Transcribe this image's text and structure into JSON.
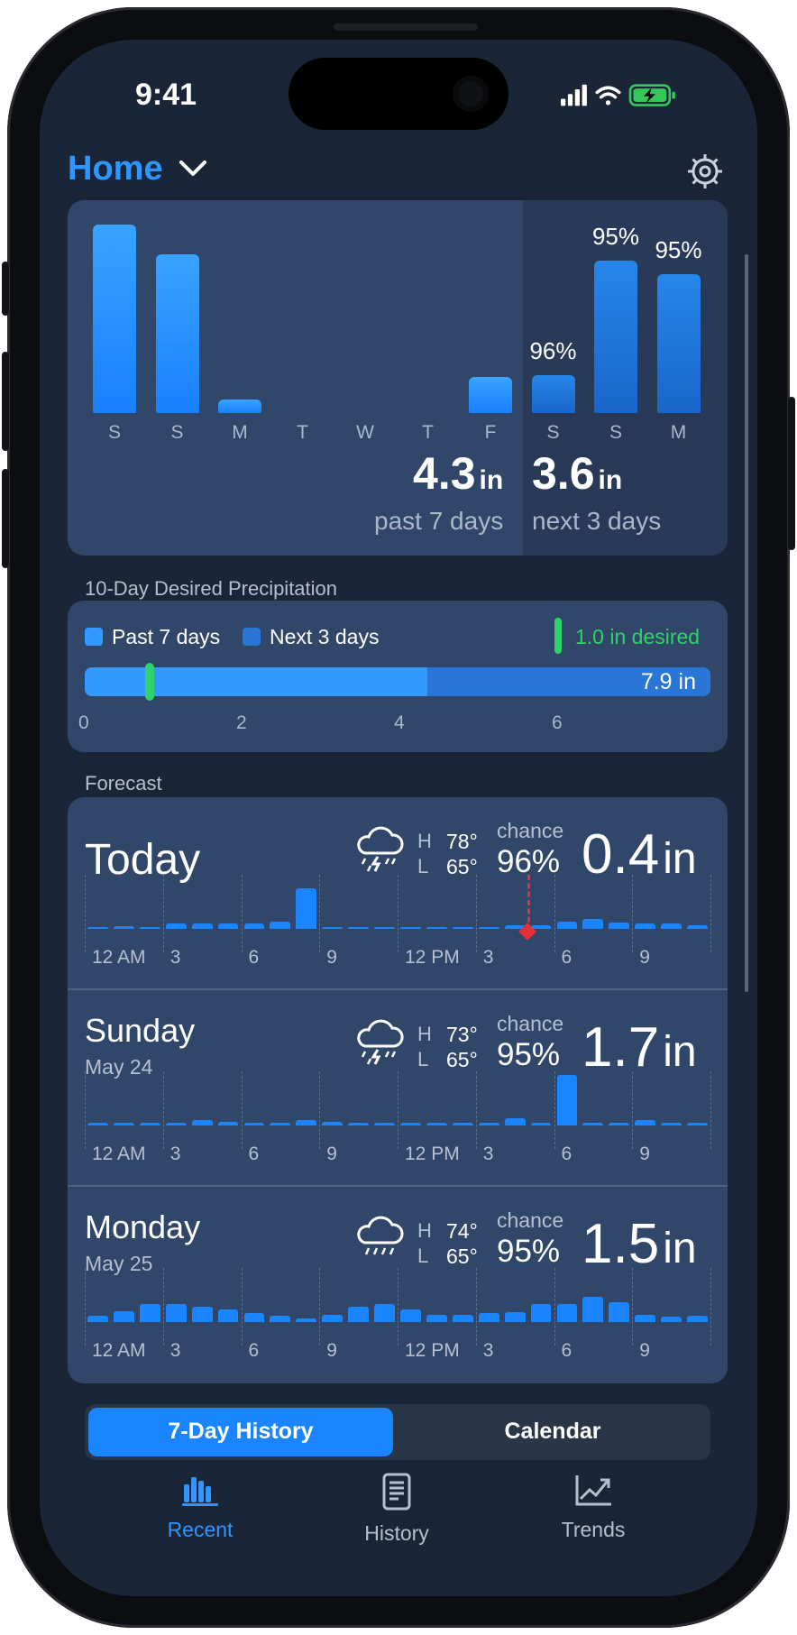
{
  "status": {
    "time": "9:41"
  },
  "header": {
    "location": "Home"
  },
  "summary": {
    "days": [
      "S",
      "S",
      "M",
      "T",
      "W",
      "T",
      "F",
      "S",
      "S",
      "M"
    ],
    "past_values": [
      0.95,
      0.8,
      0.07,
      0,
      0,
      0,
      0.18
    ],
    "future_values": [
      0.19,
      0.77,
      0.7
    ],
    "future_chances": [
      "96%",
      "95%",
      "95%"
    ],
    "past_total": "4.3",
    "past_total_unit": "in",
    "past_label": "past 7 days",
    "next_total": "3.6",
    "next_total_unit": "in",
    "next_label": "next 3 days"
  },
  "desired": {
    "section_title": "10-Day Desired Precipitation",
    "legend_past": "Past 7 days",
    "legend_next": "Next 3 days",
    "desired_label": "1.0 in desired",
    "total_label": "7.9 in",
    "axis": [
      "0",
      "2",
      "4",
      "6"
    ]
  },
  "forecast": {
    "section_title": "Forecast",
    "days": [
      {
        "name": "Today",
        "date": "",
        "high": "78°",
        "low": "65°",
        "chance_label": "chance",
        "chance": "96%",
        "amount": "0.4",
        "unit": "in",
        "icon": "thunderstorm-icon",
        "hours": [
          0,
          0.06,
          0,
          0.1,
          0.1,
          0.1,
          0.1,
          0.15,
          0.8,
          0,
          0,
          0,
          0,
          0,
          0,
          0,
          0.08,
          0.08,
          0.15,
          0.2,
          0.12,
          0.1,
          0.1,
          0.08
        ]
      },
      {
        "name": "Sunday",
        "date": "May 24",
        "high": "73°",
        "low": "65°",
        "chance_label": "chance",
        "chance": "95%",
        "amount": "1.7",
        "unit": "in",
        "icon": "thunderstorm-icon",
        "hours": [
          0.05,
          0.05,
          0.05,
          0.05,
          0.1,
          0.08,
          0.05,
          0.05,
          0.1,
          0.08,
          0.05,
          0.05,
          0.05,
          0.05,
          0.05,
          0.05,
          0.15,
          0.05,
          1.0,
          0.05,
          0.05,
          0.1,
          0.05,
          0.05
        ]
      },
      {
        "name": "Monday",
        "date": "May 25",
        "high": "74°",
        "low": "65°",
        "chance_label": "chance",
        "chance": "95%",
        "amount": "1.5",
        "unit": "in",
        "icon": "rain-icon",
        "hours": [
          0.12,
          0.22,
          0.35,
          0.35,
          0.3,
          0.25,
          0.18,
          0.12,
          0.08,
          0.15,
          0.3,
          0.35,
          0.25,
          0.15,
          0.15,
          0.18,
          0.2,
          0.35,
          0.35,
          0.5,
          0.4,
          0.15,
          0.1,
          0.12
        ]
      }
    ],
    "hour_ticks": [
      "12 AM",
      "3",
      "6",
      "9",
      "12 PM",
      "3",
      "6",
      "9"
    ]
  },
  "segmented": {
    "left": "7-Day History",
    "right": "Calendar"
  },
  "tabs": [
    {
      "label": "Recent",
      "icon": "bar-chart-icon",
      "active": true
    },
    {
      "label": "History",
      "icon": "document-icon",
      "active": false
    },
    {
      "label": "Trends",
      "icon": "trend-chart-icon",
      "active": false
    }
  ],
  "colors": {
    "accent": "#1a85ff",
    "green": "#2ed36a",
    "background": "#1a2537",
    "card": "#314769"
  }
}
